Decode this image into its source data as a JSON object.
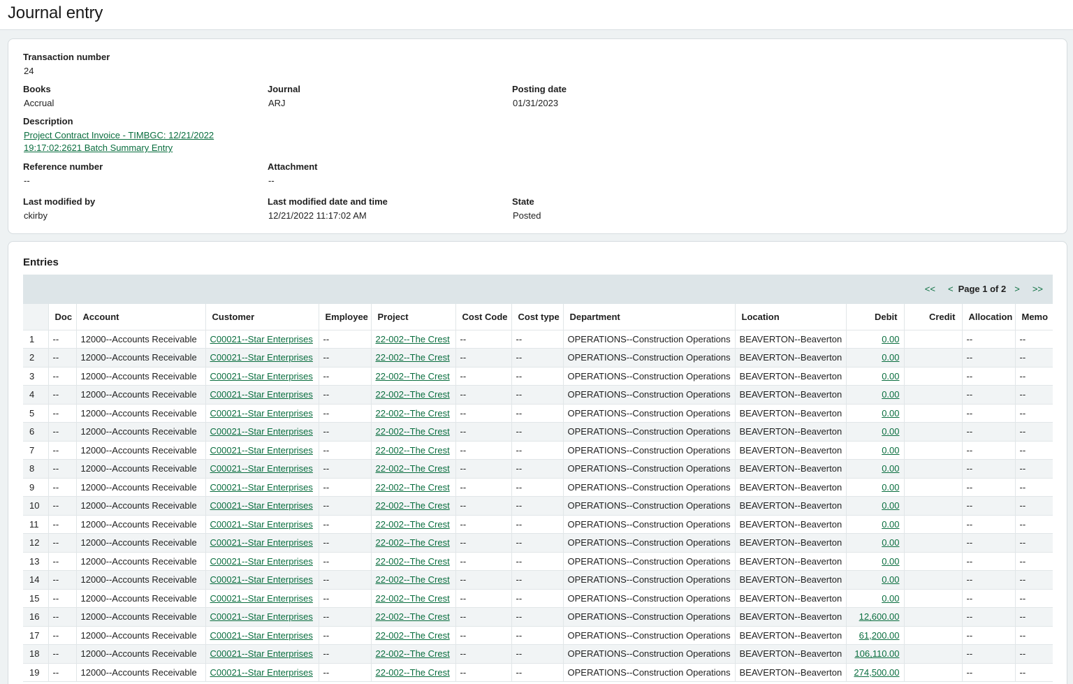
{
  "page": {
    "title": "Journal entry"
  },
  "details": {
    "transaction_number": {
      "label": "Transaction number",
      "value": "24"
    },
    "books": {
      "label": "Books",
      "value": "Accrual"
    },
    "journal": {
      "label": "Journal",
      "value": "ARJ"
    },
    "posting_date": {
      "label": "Posting date",
      "value": "01/31/2023"
    },
    "description": {
      "label": "Description",
      "line1": "Project Contract Invoice - TIMBGC: 12/21/2022",
      "line2": "19:17:02:2621 Batch Summary Entry"
    },
    "reference_number": {
      "label": "Reference number",
      "value": "--"
    },
    "attachment": {
      "label": "Attachment",
      "value": "--"
    },
    "last_modified_by": {
      "label": "Last modified by",
      "value": "ckirby"
    },
    "last_modified_date": {
      "label": "Last modified date and time",
      "value": "12/21/2022 11:17:02 AM"
    },
    "state": {
      "label": "State",
      "value": "Posted"
    }
  },
  "entries": {
    "title": "Entries",
    "pager": {
      "first": "<<",
      "prev": "<",
      "page_text": "Page 1 of 2",
      "next": ">",
      "last": ">>"
    },
    "columns": [
      "",
      "Doc",
      "Account",
      "Customer",
      "Employee",
      "Project",
      "Cost Code",
      "Cost type",
      "Department",
      "Location",
      "Debit",
      "Credit",
      "Allocation",
      "Memo"
    ],
    "rows": [
      {
        "n": "1",
        "doc": "--",
        "account": "12000--Accounts Receivable",
        "customer": "C00021--Star Enterprises",
        "employee": "--",
        "project": "22-002--The Crest",
        "cost_code": "--",
        "cost_type": "--",
        "department": "OPERATIONS--Construction Operations",
        "location": "BEAVERTON--Beaverton",
        "debit": "0.00",
        "credit": "",
        "allocation": "--",
        "memo": "--"
      },
      {
        "n": "2",
        "doc": "--",
        "account": "12000--Accounts Receivable",
        "customer": "C00021--Star Enterprises",
        "employee": "--",
        "project": "22-002--The Crest",
        "cost_code": "--",
        "cost_type": "--",
        "department": "OPERATIONS--Construction Operations",
        "location": "BEAVERTON--Beaverton",
        "debit": "0.00",
        "credit": "",
        "allocation": "--",
        "memo": "--"
      },
      {
        "n": "3",
        "doc": "--",
        "account": "12000--Accounts Receivable",
        "customer": "C00021--Star Enterprises",
        "employee": "--",
        "project": "22-002--The Crest",
        "cost_code": "--",
        "cost_type": "--",
        "department": "OPERATIONS--Construction Operations",
        "location": "BEAVERTON--Beaverton",
        "debit": "0.00",
        "credit": "",
        "allocation": "--",
        "memo": "--"
      },
      {
        "n": "4",
        "doc": "--",
        "account": "12000--Accounts Receivable",
        "customer": "C00021--Star Enterprises",
        "employee": "--",
        "project": "22-002--The Crest",
        "cost_code": "--",
        "cost_type": "--",
        "department": "OPERATIONS--Construction Operations",
        "location": "BEAVERTON--Beaverton",
        "debit": "0.00",
        "credit": "",
        "allocation": "--",
        "memo": "--"
      },
      {
        "n": "5",
        "doc": "--",
        "account": "12000--Accounts Receivable",
        "customer": "C00021--Star Enterprises",
        "employee": "--",
        "project": "22-002--The Crest",
        "cost_code": "--",
        "cost_type": "--",
        "department": "OPERATIONS--Construction Operations",
        "location": "BEAVERTON--Beaverton",
        "debit": "0.00",
        "credit": "",
        "allocation": "--",
        "memo": "--"
      },
      {
        "n": "6",
        "doc": "--",
        "account": "12000--Accounts Receivable",
        "customer": "C00021--Star Enterprises",
        "employee": "--",
        "project": "22-002--The Crest",
        "cost_code": "--",
        "cost_type": "--",
        "department": "OPERATIONS--Construction Operations",
        "location": "BEAVERTON--Beaverton",
        "debit": "0.00",
        "credit": "",
        "allocation": "--",
        "memo": "--"
      },
      {
        "n": "7",
        "doc": "--",
        "account": "12000--Accounts Receivable",
        "customer": "C00021--Star Enterprises",
        "employee": "--",
        "project": "22-002--The Crest",
        "cost_code": "--",
        "cost_type": "--",
        "department": "OPERATIONS--Construction Operations",
        "location": "BEAVERTON--Beaverton",
        "debit": "0.00",
        "credit": "",
        "allocation": "--",
        "memo": "--"
      },
      {
        "n": "8",
        "doc": "--",
        "account": "12000--Accounts Receivable",
        "customer": "C00021--Star Enterprises",
        "employee": "--",
        "project": "22-002--The Crest",
        "cost_code": "--",
        "cost_type": "--",
        "department": "OPERATIONS--Construction Operations",
        "location": "BEAVERTON--Beaverton",
        "debit": "0.00",
        "credit": "",
        "allocation": "--",
        "memo": "--"
      },
      {
        "n": "9",
        "doc": "--",
        "account": "12000--Accounts Receivable",
        "customer": "C00021--Star Enterprises",
        "employee": "--",
        "project": "22-002--The Crest",
        "cost_code": "--",
        "cost_type": "--",
        "department": "OPERATIONS--Construction Operations",
        "location": "BEAVERTON--Beaverton",
        "debit": "0.00",
        "credit": "",
        "allocation": "--",
        "memo": "--"
      },
      {
        "n": "10",
        "doc": "--",
        "account": "12000--Accounts Receivable",
        "customer": "C00021--Star Enterprises",
        "employee": "--",
        "project": "22-002--The Crest",
        "cost_code": "--",
        "cost_type": "--",
        "department": "OPERATIONS--Construction Operations",
        "location": "BEAVERTON--Beaverton",
        "debit": "0.00",
        "credit": "",
        "allocation": "--",
        "memo": "--"
      },
      {
        "n": "11",
        "doc": "--",
        "account": "12000--Accounts Receivable",
        "customer": "C00021--Star Enterprises",
        "employee": "--",
        "project": "22-002--The Crest",
        "cost_code": "--",
        "cost_type": "--",
        "department": "OPERATIONS--Construction Operations",
        "location": "BEAVERTON--Beaverton",
        "debit": "0.00",
        "credit": "",
        "allocation": "--",
        "memo": "--"
      },
      {
        "n": "12",
        "doc": "--",
        "account": "12000--Accounts Receivable",
        "customer": "C00021--Star Enterprises",
        "employee": "--",
        "project": "22-002--The Crest",
        "cost_code": "--",
        "cost_type": "--",
        "department": "OPERATIONS--Construction Operations",
        "location": "BEAVERTON--Beaverton",
        "debit": "0.00",
        "credit": "",
        "allocation": "--",
        "memo": "--"
      },
      {
        "n": "13",
        "doc": "--",
        "account": "12000--Accounts Receivable",
        "customer": "C00021--Star Enterprises",
        "employee": "--",
        "project": "22-002--The Crest",
        "cost_code": "--",
        "cost_type": "--",
        "department": "OPERATIONS--Construction Operations",
        "location": "BEAVERTON--Beaverton",
        "debit": "0.00",
        "credit": "",
        "allocation": "--",
        "memo": "--"
      },
      {
        "n": "14",
        "doc": "--",
        "account": "12000--Accounts Receivable",
        "customer": "C00021--Star Enterprises",
        "employee": "--",
        "project": "22-002--The Crest",
        "cost_code": "--",
        "cost_type": "--",
        "department": "OPERATIONS--Construction Operations",
        "location": "BEAVERTON--Beaverton",
        "debit": "0.00",
        "credit": "",
        "allocation": "--",
        "memo": "--"
      },
      {
        "n": "15",
        "doc": "--",
        "account": "12000--Accounts Receivable",
        "customer": "C00021--Star Enterprises",
        "employee": "--",
        "project": "22-002--The Crest",
        "cost_code": "--",
        "cost_type": "--",
        "department": "OPERATIONS--Construction Operations",
        "location": "BEAVERTON--Beaverton",
        "debit": "0.00",
        "credit": "",
        "allocation": "--",
        "memo": "--"
      },
      {
        "n": "16",
        "doc": "--",
        "account": "12000--Accounts Receivable",
        "customer": "C00021--Star Enterprises",
        "employee": "--",
        "project": "22-002--The Crest",
        "cost_code": "--",
        "cost_type": "--",
        "department": "OPERATIONS--Construction Operations",
        "location": "BEAVERTON--Beaverton",
        "debit": "12,600.00",
        "credit": "",
        "allocation": "--",
        "memo": "--"
      },
      {
        "n": "17",
        "doc": "--",
        "account": "12000--Accounts Receivable",
        "customer": "C00021--Star Enterprises",
        "employee": "--",
        "project": "22-002--The Crest",
        "cost_code": "--",
        "cost_type": "--",
        "department": "OPERATIONS--Construction Operations",
        "location": "BEAVERTON--Beaverton",
        "debit": "61,200.00",
        "credit": "",
        "allocation": "--",
        "memo": "--"
      },
      {
        "n": "18",
        "doc": "--",
        "account": "12000--Accounts Receivable",
        "customer": "C00021--Star Enterprises",
        "employee": "--",
        "project": "22-002--The Crest",
        "cost_code": "--",
        "cost_type": "--",
        "department": "OPERATIONS--Construction Operations",
        "location": "BEAVERTON--Beaverton",
        "debit": "106,110.00",
        "credit": "",
        "allocation": "--",
        "memo": "--"
      },
      {
        "n": "19",
        "doc": "--",
        "account": "12000--Accounts Receivable",
        "customer": "C00021--Star Enterprises",
        "employee": "--",
        "project": "22-002--The Crest",
        "cost_code": "--",
        "cost_type": "--",
        "department": "OPERATIONS--Construction Operations",
        "location": "BEAVERTON--Beaverton",
        "debit": "274,500.00",
        "credit": "",
        "allocation": "--",
        "memo": "--"
      }
    ]
  }
}
